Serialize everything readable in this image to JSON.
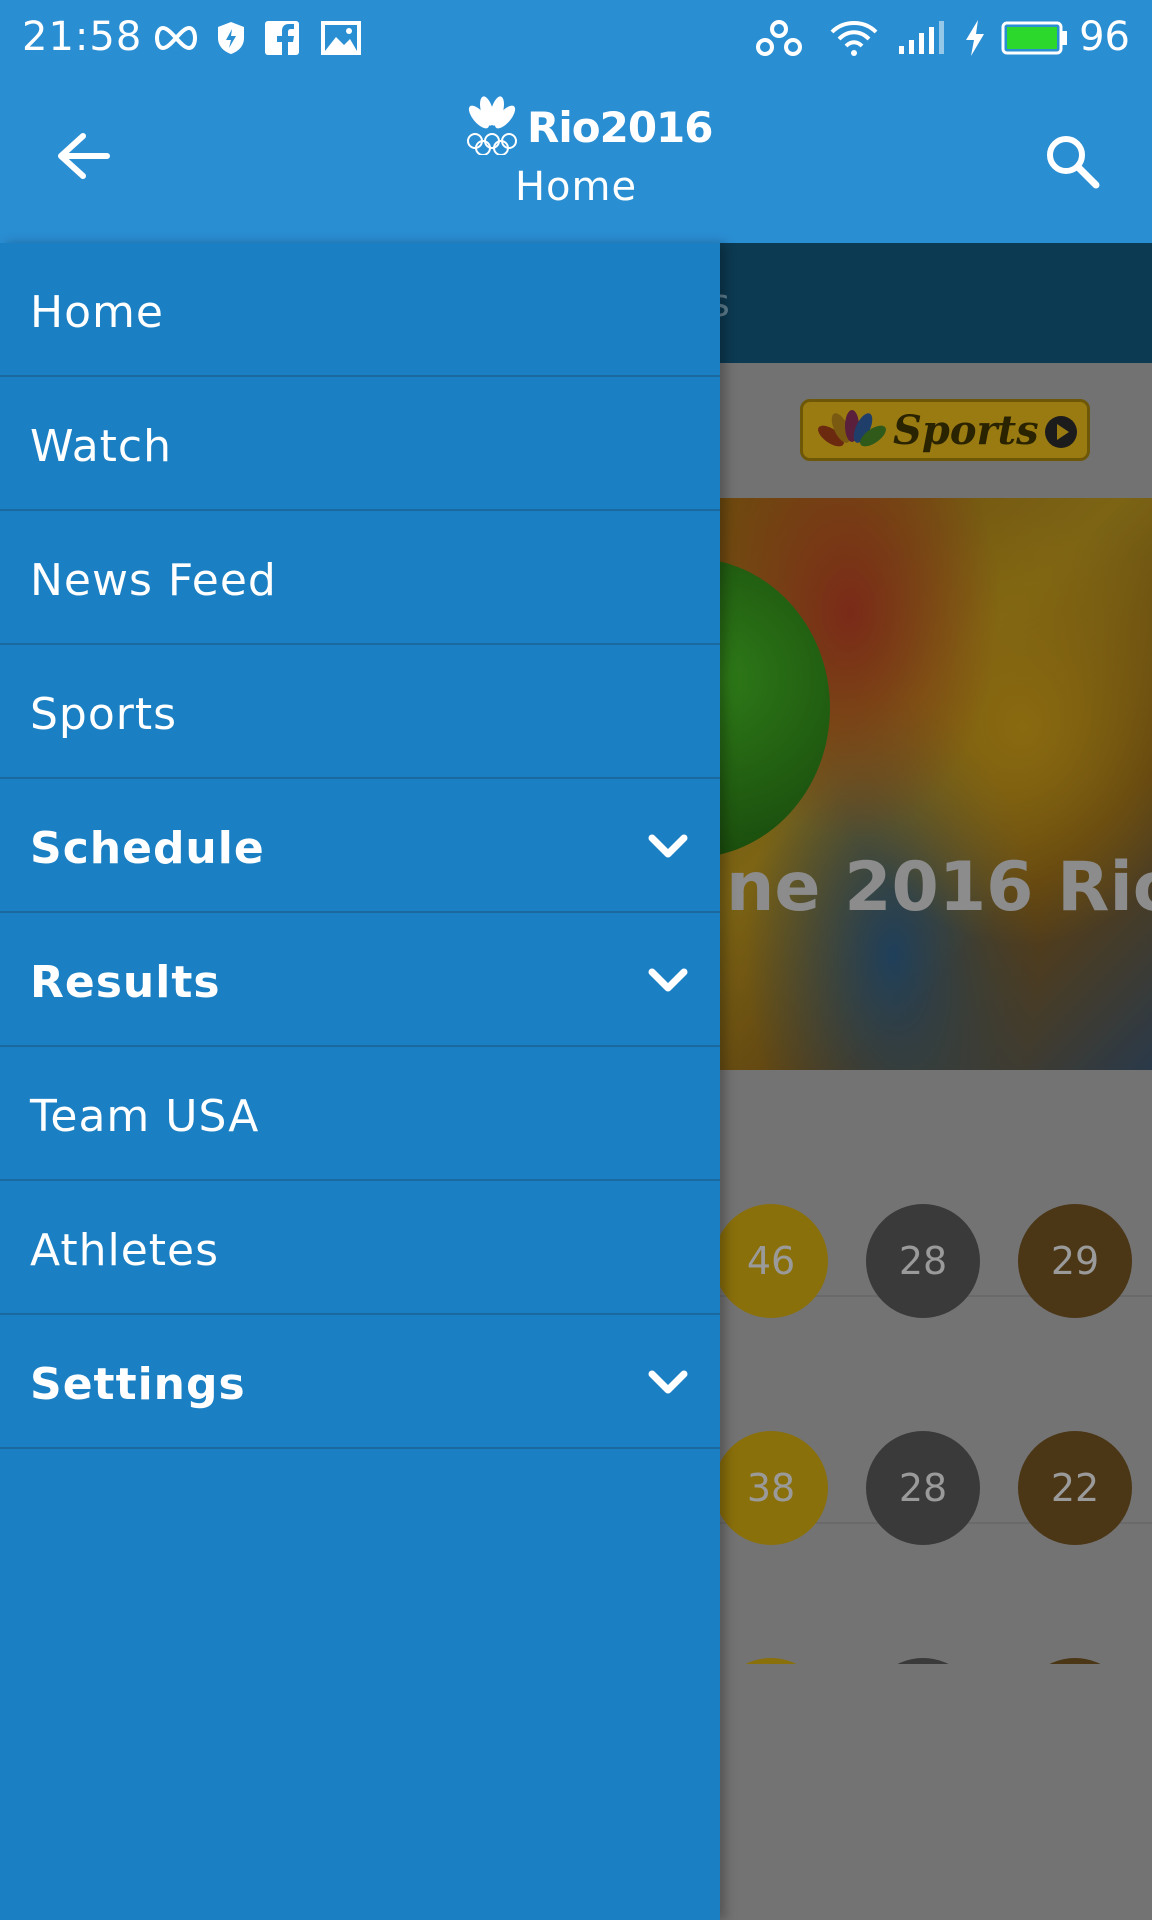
{
  "status_bar": {
    "time": "21:58",
    "battery_percent": "96",
    "icons": [
      "infinity-icon",
      "shield-icon",
      "facebook-icon",
      "image-icon",
      "share-icon",
      "wifi-icon",
      "signal-icon",
      "charging-icon",
      "battery-icon"
    ]
  },
  "app_bar": {
    "brand": "Rio2016",
    "subtitle": "Home",
    "back_icon": "arrow-left-icon",
    "search_icon": "search-icon"
  },
  "drawer": {
    "items": [
      {
        "label": "Home",
        "expandable": false
      },
      {
        "label": "Watch",
        "expandable": false
      },
      {
        "label": "News Feed",
        "expandable": false
      },
      {
        "label": "Sports",
        "expandable": false
      },
      {
        "label": "Schedule",
        "expandable": true
      },
      {
        "label": "Results",
        "expandable": true
      },
      {
        "label": "Team USA",
        "expandable": false
      },
      {
        "label": "Athletes",
        "expandable": false
      },
      {
        "label": "Settings",
        "expandable": true
      }
    ]
  },
  "background": {
    "tab_partial": "s",
    "sponsor_label": "Sports",
    "hero_text_partial": "ne 2016 Rio",
    "medal_rows": [
      {
        "gold": "46",
        "silver": "28",
        "bronze": "29"
      },
      {
        "gold": "38",
        "silver": "28",
        "bronze": "22"
      }
    ]
  },
  "colors": {
    "app_bar": "#2a8ed3",
    "drawer": "#1b80c3",
    "divider": "#1a6aa0",
    "scrim": "#6f6f6f"
  }
}
